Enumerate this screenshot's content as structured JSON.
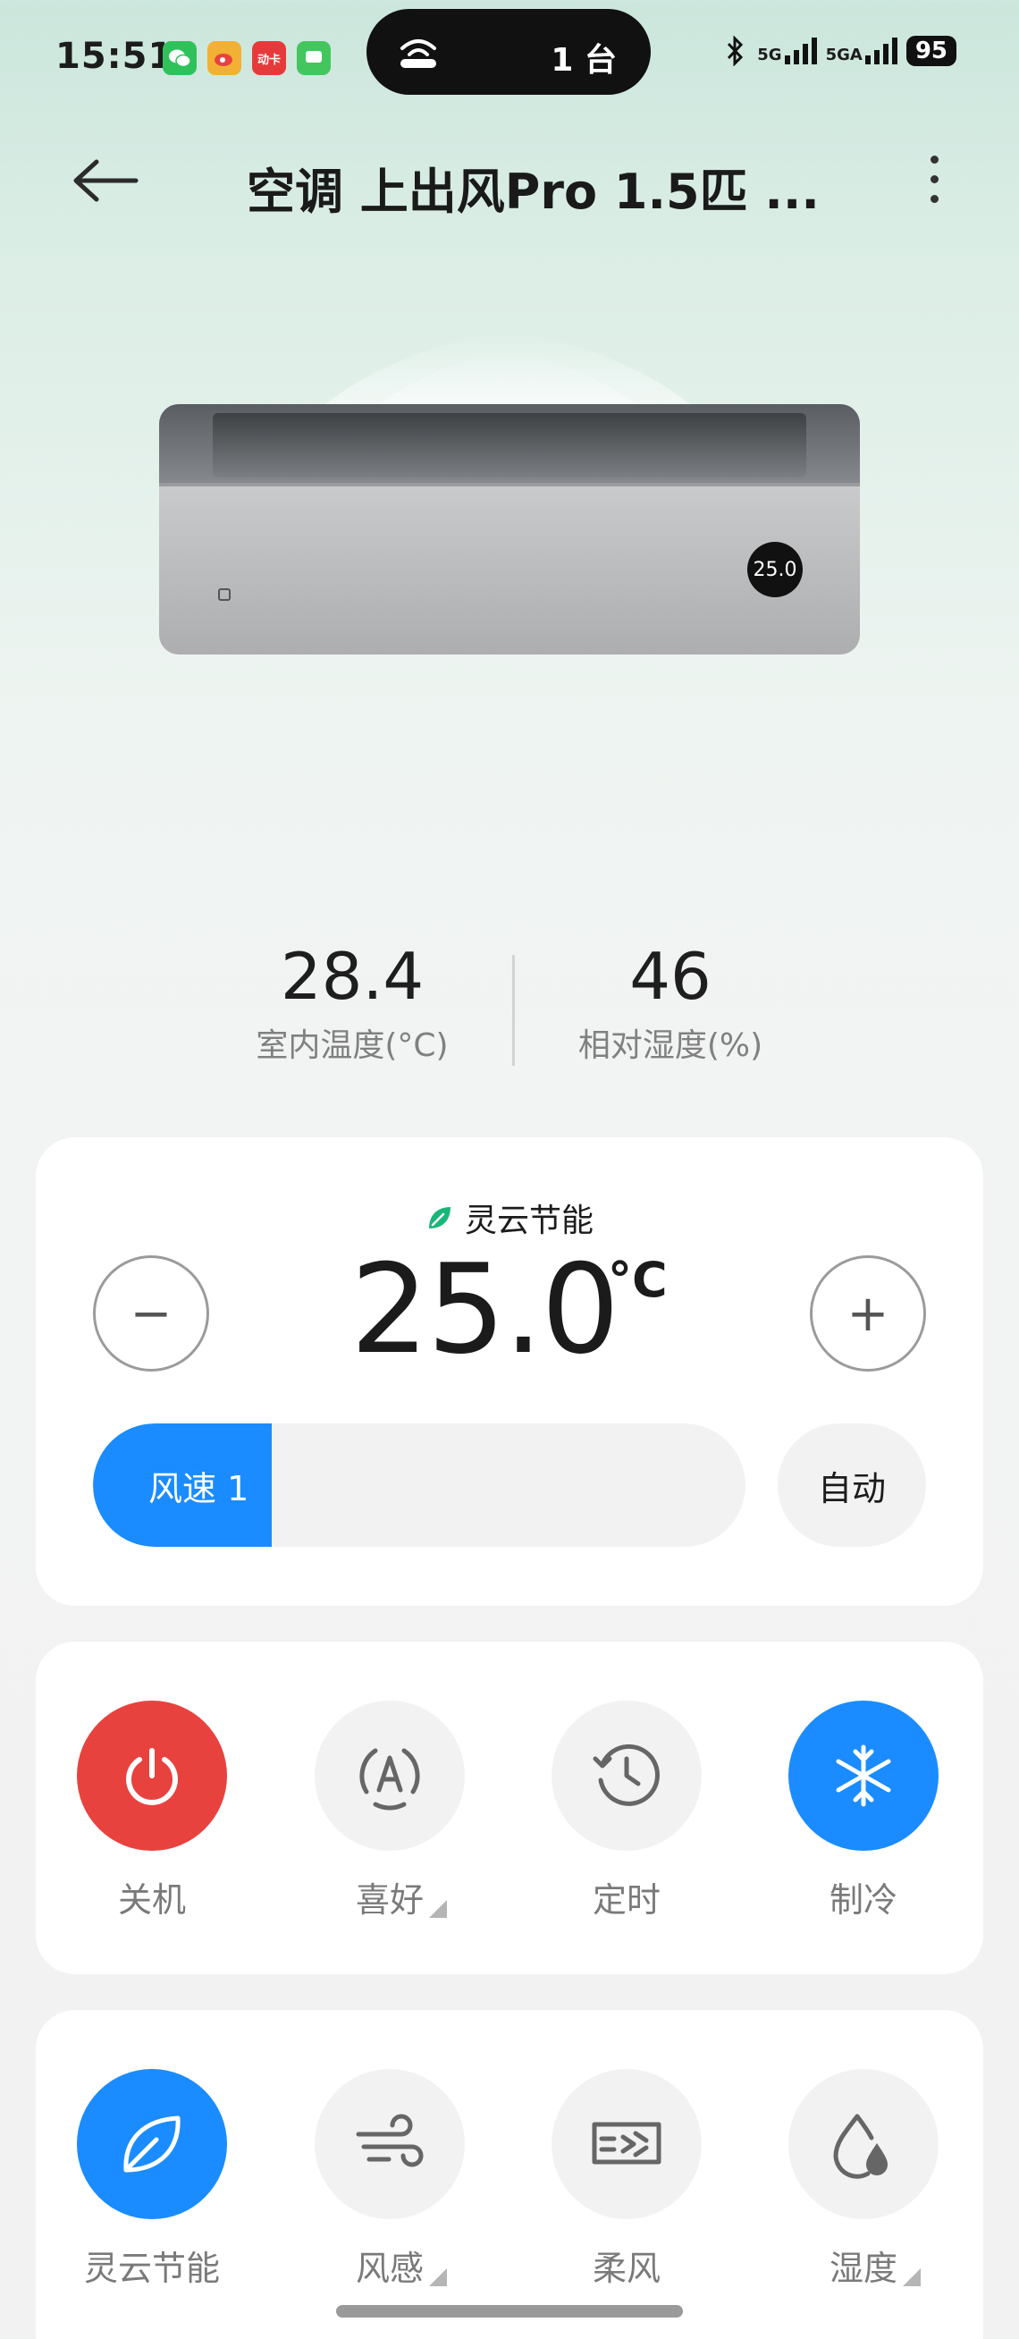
{
  "status_bar": {
    "time": "15:51",
    "notifications": [
      {
        "icon": "wechat-icon",
        "color": "#2fc25b",
        "text": ""
      },
      {
        "icon": "weibo-icon",
        "color": "#f2b134",
        "text": ""
      },
      {
        "icon": "app-badge-icon",
        "color": "#e63a3a",
        "text": "动卡"
      },
      {
        "icon": "messages-icon",
        "color": "#43c65d",
        "text": ""
      }
    ],
    "island_text": "1 台",
    "signal_1": "5G",
    "signal_2": "5GA",
    "battery": "95"
  },
  "header": {
    "title": "空调 上出风Pro 1.5匹 ..."
  },
  "device": {
    "panel_display": "25.0"
  },
  "readings": {
    "indoor_temp": "28.4",
    "indoor_temp_label": "室内温度(°C)",
    "humidity": "46",
    "humidity_label": "相对湿度(%)"
  },
  "control": {
    "eco_label": "灵云节能",
    "target_temp": "25.0",
    "temp_unit": "°C",
    "minus": "−",
    "plus": "+",
    "fan_speed_label": "风速 1",
    "fan_speed_fraction": 0.16,
    "fan_auto_label": "自动"
  },
  "modes": [
    {
      "label": "关机",
      "icon": "power-icon",
      "active": true,
      "color": "#e8423f",
      "dropdown": false
    },
    {
      "label": "喜好",
      "icon": "preference-icon",
      "active": false,
      "dropdown": true
    },
    {
      "label": "定时",
      "icon": "timer-icon",
      "active": false,
      "dropdown": false
    },
    {
      "label": "制冷",
      "icon": "snowflake-icon",
      "active": true,
      "color": "#1a8cff",
      "dropdown": false
    }
  ],
  "features": [
    {
      "label": "灵云节能",
      "icon": "leaf-icon",
      "active": true,
      "color": "#1a8cff",
      "dropdown": false
    },
    {
      "label": "风感",
      "icon": "wind-icon",
      "active": false,
      "dropdown": true
    },
    {
      "label": "柔风",
      "icon": "soft-wind-icon",
      "active": false,
      "dropdown": false
    },
    {
      "label": "湿度",
      "icon": "humidity-icon",
      "active": false,
      "dropdown": true
    }
  ],
  "colors": {
    "accent": "#1a8cff",
    "power_red": "#e8423f",
    "eco_green": "#19b67a"
  }
}
